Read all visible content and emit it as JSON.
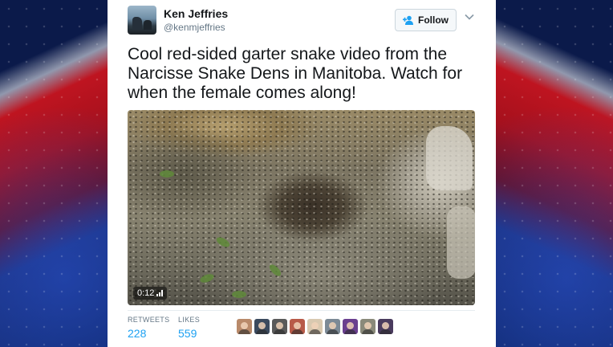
{
  "tweet": {
    "author_name": "Ken Jeffries",
    "author_handle": "@kenmjeffries",
    "follow_label": "Follow",
    "text": "Cool red-sided garter snake video from the Narcisse Snake Dens in Manitoba. Watch for when the female comes along!",
    "video": {
      "duration": "0:12"
    },
    "stats": {
      "retweets_label": "RETWEETS",
      "retweets_count": "228",
      "likes_label": "LIKES",
      "likes_count": "559"
    },
    "liker_avatars": [
      {
        "color": "#b98a6a"
      },
      {
        "color": "#3b4a5e"
      },
      {
        "color": "#5a5a5a"
      },
      {
        "color": "#b85a48"
      },
      {
        "color": "#d9c9b0"
      },
      {
        "color": "#7c8a96"
      },
      {
        "color": "#6a3f8f"
      },
      {
        "color": "#8a8a7a"
      },
      {
        "color": "#4a3b5e"
      }
    ]
  },
  "colors": {
    "link_blue": "#1da1f2",
    "text_dark": "#14171a",
    "text_muted": "#657786"
  }
}
